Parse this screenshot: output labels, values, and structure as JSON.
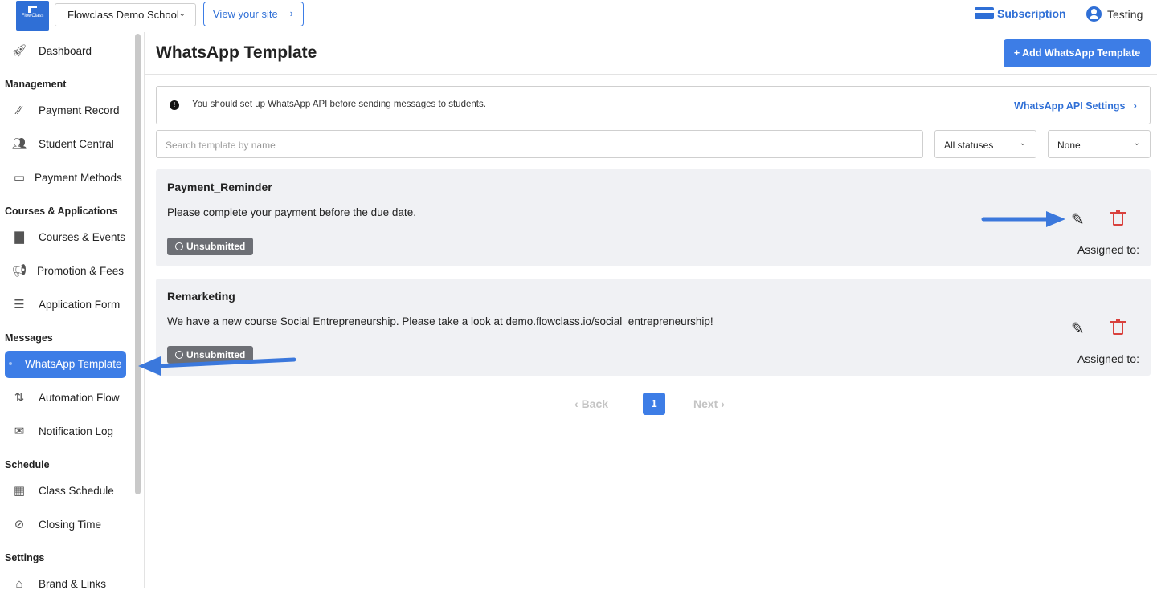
{
  "topbar": {
    "logo_text": "FlowClass",
    "school": "Flowclass Demo School",
    "view_site": "View your site",
    "subscription": "Subscription",
    "user": "Testing"
  },
  "sidebar": {
    "dashboard": "Dashboard",
    "management": "Management",
    "payment_record": "Payment Record",
    "student_central": "Student Central",
    "payment_methods": "Payment Methods",
    "courses_apps": "Courses & Applications",
    "courses_events": "Courses & Events",
    "promotion_fees": "Promotion & Fees",
    "application_form": "Application Form",
    "messages": "Messages",
    "whatsapp_template": "WhatsApp Template",
    "automation_flow": "Automation Flow",
    "notification_log": "Notification Log",
    "schedule": "Schedule",
    "class_schedule": "Class Schedule",
    "closing_time": "Closing Time",
    "settings": "Settings",
    "brand_links": "Brand & Links"
  },
  "main": {
    "title": "WhatsApp Template",
    "add_button": "+ Add WhatsApp Template",
    "notice_text": "You should set up WhatsApp API before sending messages to students.",
    "notice_link": "WhatsApp API Settings",
    "search_placeholder": "Search template by name",
    "status_filter": "All statuses",
    "second_filter": "None"
  },
  "templates": [
    {
      "name": "Payment_Reminder",
      "message": "Please complete your payment before the due date.",
      "status": "Unsubmitted",
      "assigned": "Assigned to:"
    },
    {
      "name": "Remarketing",
      "message": "We have a new course Social Entrepreneurship. Please take a look at demo.flowclass.io/social_entrepreneurship!",
      "status": "Unsubmitted",
      "assigned": "Assigned to:"
    }
  ],
  "pagination": {
    "back": "Back",
    "page": "1",
    "next": "Next"
  },
  "colors": {
    "accent": "#3d7de6",
    "delete": "#d9413d",
    "badge": "#6d6f75"
  }
}
